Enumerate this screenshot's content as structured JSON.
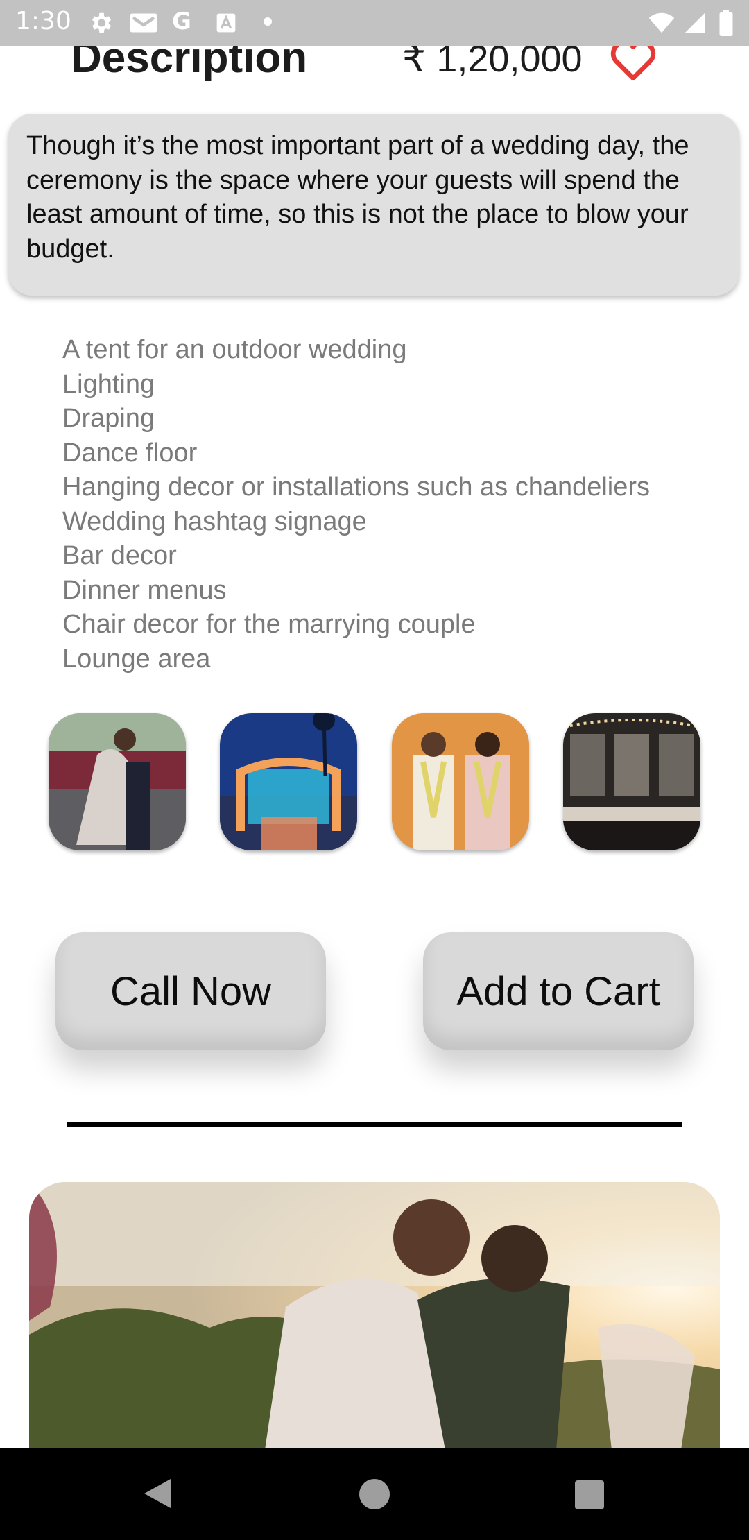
{
  "status_bar": {
    "time": "1:30",
    "icons": [
      "gear-icon",
      "mail-icon",
      "google-icon",
      "a-icon",
      "dot-icon",
      "wifi-icon",
      "signal-icon",
      "battery-icon"
    ],
    "google_glyph": "G"
  },
  "header": {
    "title": "Description",
    "price": "₹ 1,20,000",
    "favorite_icon": "heart-outline-icon",
    "favorite_color": "#e53935"
  },
  "description": {
    "text": "Though it’s the most important part of a wedding day, the ceremony is the space where your guests will spend the least amount of time, so this is not the place to blow your budget."
  },
  "features": [
    "A tent for an outdoor wedding",
    "Lighting",
    "Draping",
    "Dance floor",
    "Hanging decor or installations such as chandeliers",
    "Wedding hashtag signage",
    "Bar decor",
    "Dinner menus",
    "Chair decor for the marrying couple",
    "Lounge area"
  ],
  "gallery": [
    {
      "name": "couple-embrace-thumbnail"
    },
    {
      "name": "mandap-stage-thumbnail"
    },
    {
      "name": "bride-groom-garlands-thumbnail"
    },
    {
      "name": "banquet-hall-thumbnail"
    }
  ],
  "actions": {
    "call_label": "Call Now",
    "cart_label": "Add to Cart"
  },
  "hero": {
    "name": "couple-kiss-hero-image"
  },
  "nav_bar": {
    "back_icon": "back-icon",
    "home_icon": "home-icon",
    "recents_icon": "recents-icon"
  }
}
